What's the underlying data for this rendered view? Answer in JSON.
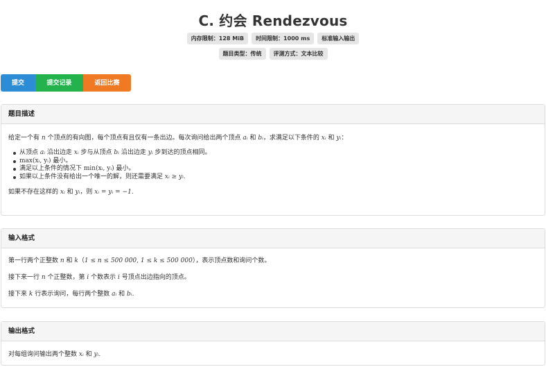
{
  "problem": {
    "title": "C. 约会 Rendezvous"
  },
  "tags": {
    "memory": "内存限制：128 MiB",
    "time": "时间限制：1000 ms",
    "io": "标准输入输出",
    "type": "题目类型：传统",
    "judge": "评测方式：文本比较"
  },
  "buttons": {
    "submit": "提交",
    "records": "提交记录",
    "back": "返回比赛"
  },
  "description": {
    "heading": "题目描述",
    "p1": {
      "a": "给定一个有 ",
      "n": "n",
      "b": " 个顶点的有向图，每个顶点有且仅有一条出边。每次询问给出两个顶点 ",
      "ai": "aᵢ",
      "c": " 和 ",
      "bi": "bᵢ",
      "d": "，求满足以下条件的 ",
      "xi": "xᵢ",
      "e": " 和 ",
      "yi": "yᵢ",
      "f": "："
    },
    "b1": {
      "a": "从顶点 ",
      "ai": "aᵢ",
      "b": " 沿出边走 ",
      "xi": "xᵢ",
      "c": " 步与从顶点 ",
      "bi": "bᵢ",
      "d": " 沿出边走 ",
      "yi": "yᵢ",
      "e": " 步到达的顶点相同。"
    },
    "b2": {
      "expr": "max(xᵢ, yᵢ)",
      "a": " 最小。"
    },
    "b3": {
      "a": "满足以上条件的情况下 ",
      "expr": "min(xᵢ, yᵢ)",
      "b": " 最小。"
    },
    "b4": {
      "a": "如果以上条件没有给出一个唯一的解，则还需要满足 ",
      "expr": "xᵢ ≥ yᵢ",
      "b": "."
    },
    "p2": {
      "a": "如果不存在这样的 ",
      "xi": "xᵢ",
      "b": " 和 ",
      "yi": "yᵢ",
      "c": "，则 ",
      "expr": "xᵢ = yᵢ = −1",
      "d": "."
    }
  },
  "input": {
    "heading": "输入格式",
    "p1": {
      "a": "第一行两个正整数 ",
      "n": "n",
      "b": " 和 ",
      "k": "k",
      "c": "（",
      "expr": "1 ≤ n ≤ 500 000, 1 ≤ k ≤ 500 000",
      "d": "），表示顶点数和询问个数。"
    },
    "p2": {
      "a": "接下来一行 ",
      "n": "n",
      "b": " 个正整数，第 ",
      "i1": "i",
      "c": " 个数表示 ",
      "i2": "i",
      "d": " 号顶点出边指向的顶点。"
    },
    "p3": {
      "a": "接下来 ",
      "k": "k",
      "b": " 行表示询问，每行两个整数 ",
      "ai": "aᵢ",
      "c": " 和 ",
      "bi": "bᵢ",
      "d": "."
    }
  },
  "output": {
    "heading": "输出格式",
    "p1": {
      "a": "对每组询问输出两个整数 ",
      "xi": "xᵢ",
      "b": " 和 ",
      "yi": "yᵢ",
      "c": "."
    }
  }
}
